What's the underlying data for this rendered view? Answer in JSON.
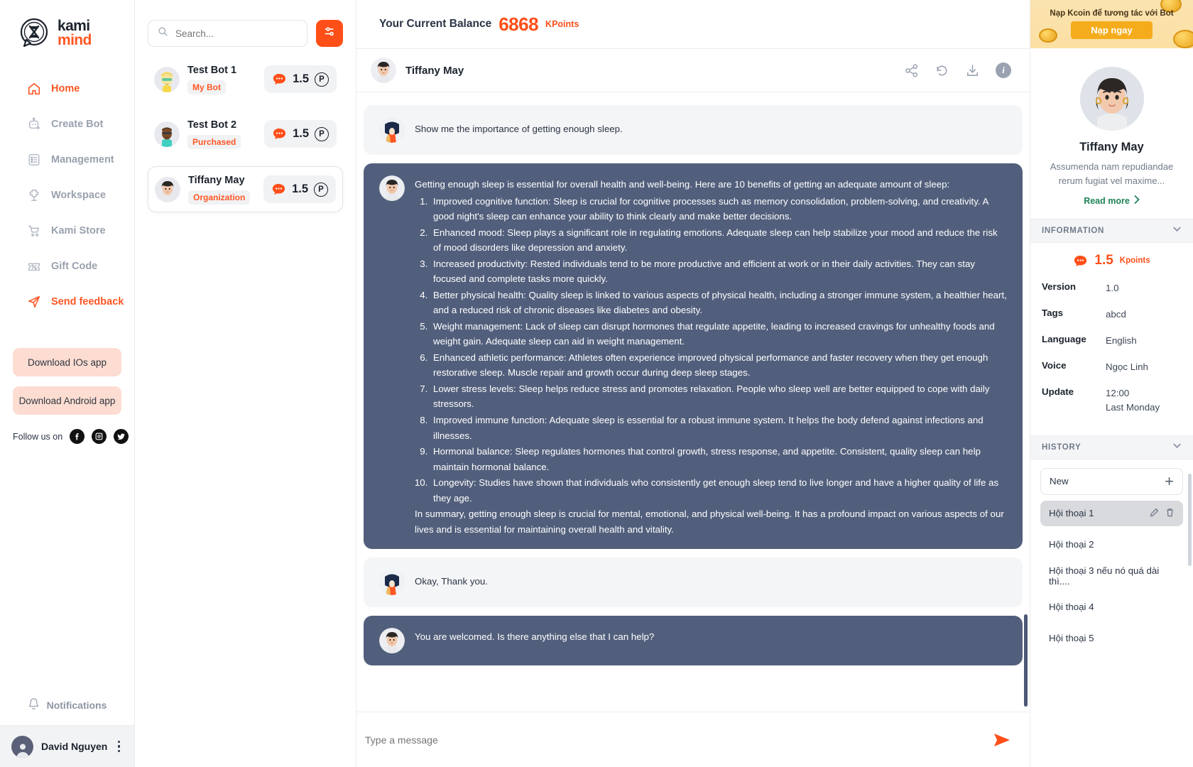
{
  "brand": {
    "line1": "kami",
    "line2": "mind"
  },
  "sidebar": {
    "items": [
      {
        "label": "Home",
        "icon": "home-icon",
        "state": "active"
      },
      {
        "label": "Create Bot",
        "icon": "create-bot-icon",
        "state": "default"
      },
      {
        "label": "Management",
        "icon": "management-icon",
        "state": "default"
      },
      {
        "label": "Workspace",
        "icon": "workspace-icon",
        "state": "default"
      },
      {
        "label": "Kami Store",
        "icon": "cart-icon",
        "state": "default"
      },
      {
        "label": "Gift Code",
        "icon": "gift-code-icon",
        "state": "default"
      },
      {
        "label": "Send feedback",
        "icon": "send-feedback-icon",
        "state": "accent"
      }
    ],
    "download_ios": "Download IOs app",
    "download_android": "Download Android app",
    "follow_label": "Follow us on",
    "social": [
      "facebook-icon",
      "instagram-icon",
      "twitter-icon"
    ],
    "notifications": "Notifications",
    "profile_name": "David Nguyen"
  },
  "botlist": {
    "search_placeholder": "Search...",
    "search_value": "",
    "filter_icon": "filter-sliders-icon",
    "bots": [
      {
        "name": "Test Bot 1",
        "tag": "My Bot",
        "price": "1.5",
        "unit": "P",
        "selected": false
      },
      {
        "name": "Test Bot 2",
        "tag": "Purchased",
        "price": "1.5",
        "unit": "P",
        "selected": false
      },
      {
        "name": "Tiffany May",
        "tag": "Organization",
        "price": "1.5",
        "unit": "P",
        "selected": true
      }
    ]
  },
  "balance": {
    "label": "Your Current Balance",
    "value": "6868",
    "unit": "KPoints"
  },
  "chat": {
    "header_name": "Tiffany May",
    "actions": [
      "share-icon",
      "refresh-icon",
      "download-icon",
      "info-icon"
    ],
    "composer_placeholder": "Type a message",
    "composer_value": "",
    "send_icon": "send-icon",
    "messages": [
      {
        "role": "user",
        "text": "Show me the importance of getting enough sleep."
      },
      {
        "role": "bot",
        "intro": "Getting enough sleep is essential for overall health and well-being. Here are 10 benefits of getting an adequate amount of sleep:",
        "items": [
          "Improved cognitive function: Sleep is crucial for cognitive processes such as memory consolidation, problem-solving, and creativity. A good night's sleep can enhance your ability to think clearly and make better decisions.",
          "Enhanced mood: Sleep plays a significant role in regulating emotions. Adequate sleep can help stabilize your mood and reduce the risk of mood disorders like depression and anxiety.",
          "Increased productivity: Rested individuals tend to be more productive and efficient at work or in their daily activities. They can stay focused and complete tasks more quickly.",
          "Better physical health: Quality sleep is linked to various aspects of physical health, including a stronger immune system, a healthier heart, and a reduced risk of chronic diseases like diabetes and obesity.",
          "Weight management: Lack of sleep can disrupt hormones that regulate appetite, leading to increased cravings for unhealthy foods and weight gain. Adequate sleep can aid in weight management.",
          "Enhanced athletic performance: Athletes often experience improved physical performance and faster recovery when they get enough restorative sleep. Muscle repair and growth occur during deep sleep stages.",
          "Lower stress levels: Sleep helps reduce stress and promotes relaxation. People who sleep well are better equipped to cope with daily stressors.",
          "Improved immune function: Adequate sleep is essential for a robust immune system. It helps the body defend against infections and illnesses.",
          "Hormonal balance: Sleep regulates hormones that control growth, stress response, and appetite. Consistent, quality sleep can help maintain hormonal balance.",
          "Longevity: Studies have shown that individuals who consistently get enough sleep tend to live longer and have a higher quality of life as they age."
        ],
        "outro": "In summary, getting enough sleep is crucial for mental, emotional, and physical well-being. It has a profound impact on various aspects of our lives and is essential for maintaining overall health and vitality."
      },
      {
        "role": "user",
        "text": "Okay, Thank you."
      },
      {
        "role": "bot",
        "text": "You are welcomed. Is there anything else that I can help?"
      }
    ]
  },
  "rightpanel": {
    "promo": {
      "text": "Nạp Kcoin để tương tác với Bot",
      "button": "Nạp ngay"
    },
    "bot": {
      "name": "Tiffany May",
      "description": "Assumenda nam repudiandae rerum fugiat vel maxime...",
      "read_more": "Read more"
    },
    "information": {
      "section_title": "INFORMATION",
      "kpoints_value": "1.5",
      "kpoints_unit": "Kpoints",
      "rows": [
        {
          "key": "Version",
          "value": "1.0"
        },
        {
          "key": "Tags",
          "value": "abcd"
        },
        {
          "key": "Language",
          "value": "English"
        },
        {
          "key": "Voice",
          "value": "Ngọc Linh"
        },
        {
          "key": "Update",
          "value": "12:00\nLast Monday"
        }
      ]
    },
    "history": {
      "section_title": "HISTORY",
      "new_label": "New",
      "items": [
        {
          "label": "Hội thoại 1",
          "active": true
        },
        {
          "label": "Hội thoại 2",
          "active": false
        },
        {
          "label": "Hội thoại 3 nếu nó quá dài thì....",
          "active": false
        },
        {
          "label": "Hội thoại 4",
          "active": false
        },
        {
          "label": "Hội thoại 5",
          "active": false
        }
      ]
    }
  },
  "colors": {
    "accent": "#ff4f18",
    "bot_bubble": "#525f7c",
    "user_bubble": "#f4f5f7",
    "promo": "#f5ac1c",
    "green": "#1e8355"
  }
}
